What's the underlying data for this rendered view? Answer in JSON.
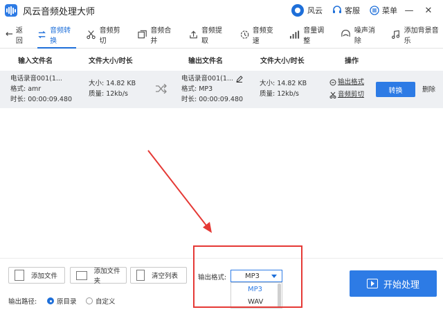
{
  "titlebar": {
    "app_title": "风云音频处理大师",
    "fengyun_label": "风云",
    "service_label": "客服",
    "menu_label": "菜单"
  },
  "toolbar": {
    "back_label": "返回",
    "tools": [
      "音频转换",
      "音频剪切",
      "音频合并",
      "音频提取",
      "音频变速",
      "音量调整",
      "噪声消除",
      "添加背景音乐"
    ]
  },
  "table": {
    "headers": [
      "输入文件名",
      "文件大小/时长",
      "输出文件名",
      "文件大小/时长",
      "操作"
    ],
    "row": {
      "input_name": "电话录音001(1...",
      "input_format": "格式:  amr",
      "input_duration": "时长:  00:00:09.480",
      "input_size": "大小:  14.82 KB",
      "input_quality": "质量:  12kb/s",
      "output_name": "电话录音001(1...",
      "output_format": "格式:  MP3",
      "output_duration": "时长:  00:00:09.480",
      "output_size": "大小:  14.82 KB",
      "output_quality": "质量:  12kb/s",
      "output_format_link": "输出格式",
      "audio_cut_link": "音频剪切",
      "convert_label": "转换",
      "delete_label": "删除"
    }
  },
  "bottom": {
    "add_file": "添加文件",
    "add_folder": "添加文件夹",
    "clear_list": "清空列表",
    "output_path_label": "输出路径:",
    "original_dir": "原目录",
    "custom": "自定义",
    "format_label": "输出格式:",
    "format_selected": "MP3",
    "format_options": [
      "MP3",
      "WAV"
    ],
    "start_label": "开始处理"
  },
  "colors": {
    "accent": "#2d7be5",
    "annotation": "#e53935"
  }
}
